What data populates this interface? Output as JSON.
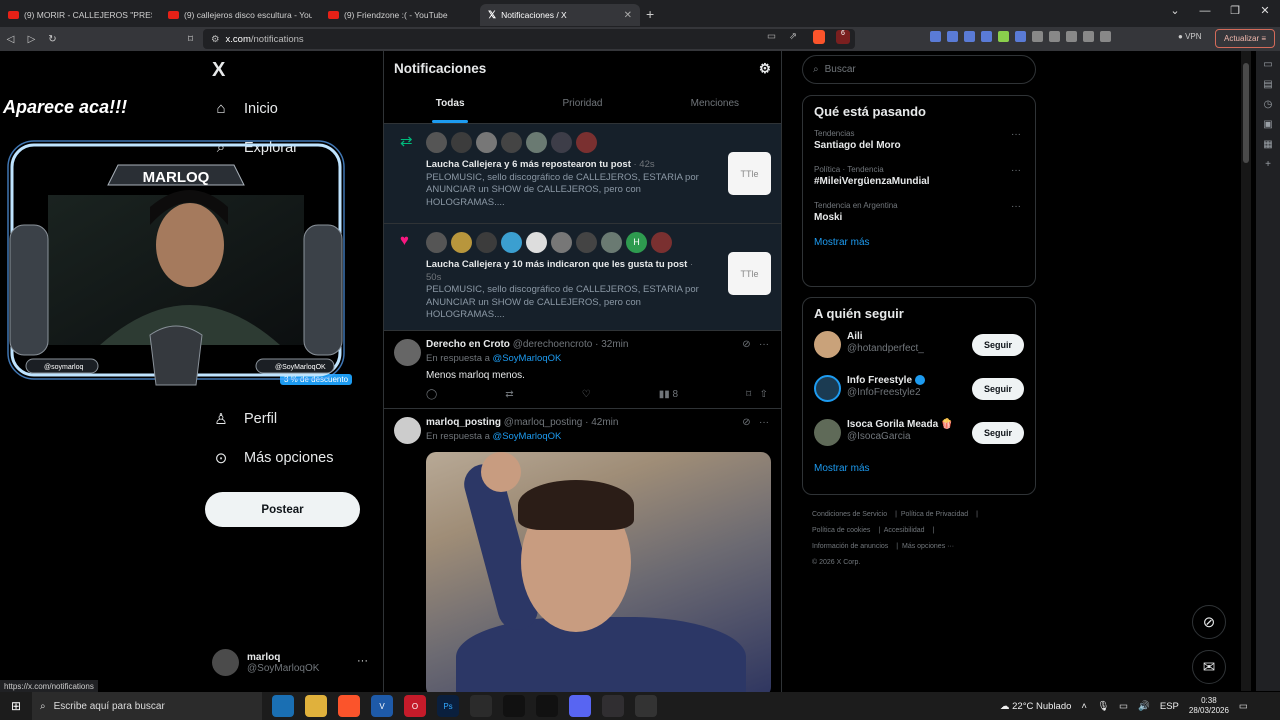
{
  "browser": {
    "tabs": [
      {
        "title": "(9) MORIR - CALLEJEROS \"PRESION\"",
        "icon": "youtube-icon"
      },
      {
        "title": "(9) callejeros disco escultura - YouTube",
        "icon": "youtube-icon"
      },
      {
        "title": "(9) Friendzone :( - YouTube",
        "icon": "youtube-icon"
      },
      {
        "title": "Notificaciones / X",
        "icon": "x-icon",
        "active": true
      }
    ],
    "url_host": "x.com",
    "url_path": "/notifications",
    "vpn_label": "VPN",
    "update_label": "Actualizar",
    "brave_badge": "6",
    "status_url": "https://x.com/notifications"
  },
  "overlay": {
    "caption": "Aparece aca!!!",
    "channel_name": "MARLOQ",
    "instagram": "@soymarloq",
    "twitter": "@SoyMarloqOK"
  },
  "sidebar": {
    "logo": "X",
    "items": [
      {
        "label": "Inicio",
        "icon": "home-icon"
      },
      {
        "label": "Explorar",
        "icon": "search-icon"
      },
      {
        "label": "Perfil",
        "icon": "profile-icon"
      },
      {
        "label": "Más opciones",
        "icon": "more-options-icon"
      }
    ],
    "discount_badge": "3 % de descuento",
    "post_button": "Postear",
    "account": {
      "name": "marloq",
      "handle": "@SoyMarloqOK"
    }
  },
  "main": {
    "title": "Notificaciones",
    "tabs": [
      "Todas",
      "Prioridad",
      "Menciones"
    ],
    "notifications": [
      {
        "type": "repost",
        "actor": "Laucha Callejera",
        "action": " y 6 más repostearon tu post",
        "time": "· 42s",
        "body": "PELOMUSIC, sello discográfico de CALLEJEROS, ESTARIA por ANUNCIAR un SHOW de CALLEJEROS, pero con HOLOGRAMAS....",
        "thumb": "TTle"
      },
      {
        "type": "like",
        "actor": "Laucha Callejera",
        "action": " y 10 más indicaron que les gusta tu post",
        "time": "· 50s",
        "body": "PELOMUSIC, sello discográfico de CALLEJEROS, ESTARIA por ANUNCIAR un SHOW de CALLEJEROS, pero con HOLOGRAMAS....",
        "thumb": "TTle"
      }
    ],
    "posts": [
      {
        "name": "Derecho en Croto",
        "handle": "@derechoencroto",
        "time": "· 32min",
        "reply_prefix": "En respuesta a ",
        "reply_to": "@SoyMarloqOK",
        "text": "Menos marloq menos.",
        "views": "8"
      },
      {
        "name": "marloq_posting",
        "handle": "@marloq_posting",
        "time": "· 42min",
        "reply_prefix": "En respuesta a ",
        "reply_to": "@SoyMarloqOK"
      }
    ]
  },
  "right": {
    "search_placeholder": "Buscar",
    "trends_title": "Qué está pasando",
    "trends": [
      {
        "context": "Tendencias",
        "name": "Santiago del Moro"
      },
      {
        "context": "Política · Tendencia",
        "name": "#MileiVergüenzaMundial"
      },
      {
        "context": "Tendencia en Argentina",
        "name": "Moski"
      }
    ],
    "show_more": "Mostrar más",
    "follow_title": "A quién seguir",
    "follow": [
      {
        "name": "Aili",
        "handle": "@hotandperfect_",
        "verified": false
      },
      {
        "name": "Info Freestyle",
        "handle": "@InfoFreestyle2",
        "verified": true
      },
      {
        "name": "Isoca Gorila Meada 🍿",
        "handle": "@IsocaGarcia",
        "verified": false
      }
    ],
    "follow_button": "Seguir",
    "footer_links": [
      "Condiciones de Servicio",
      "Política de Privacidad",
      "Política de cookies",
      "Accesibilidad",
      "Información de anuncios",
      "Más opciones ···"
    ],
    "copyright": "© 2026 X Corp."
  },
  "taskbar": {
    "search_placeholder": "Escribe aquí para buscar",
    "weather": "22°C  Nublado",
    "lang": "ESP",
    "time": "0:38",
    "date": "28/03/2026"
  },
  "colors": {
    "accent": "#1d9bf0",
    "repost": "#00ba7c",
    "like": "#f91880",
    "background": "#000000"
  }
}
